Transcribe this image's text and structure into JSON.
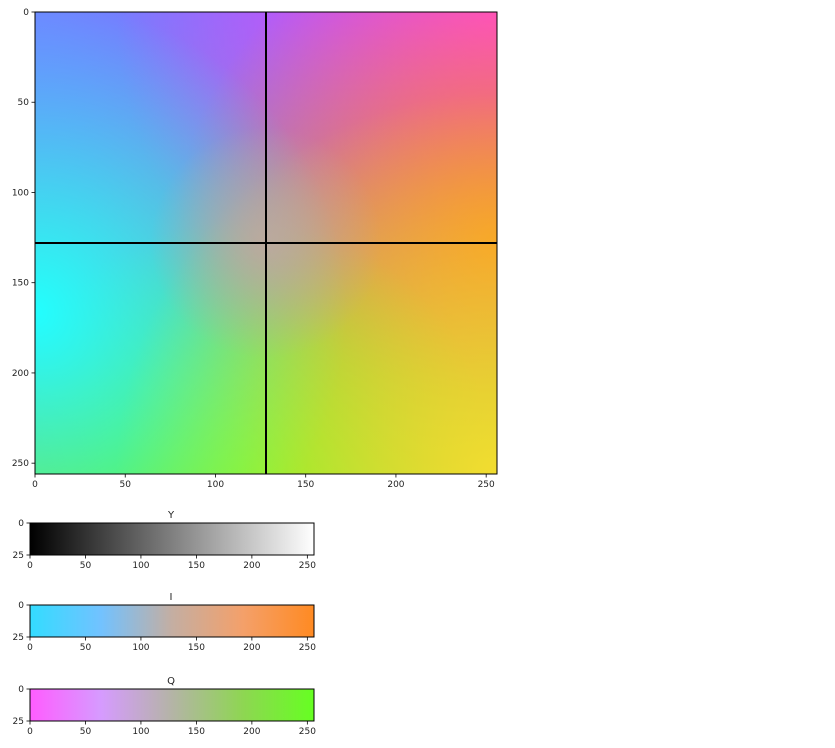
{
  "chart_data": [
    {
      "type": "heatmap",
      "title": "",
      "xlabel": "",
      "ylabel": "",
      "xlim": [
        0,
        256
      ],
      "ylim": [
        256,
        0
      ],
      "x_ticks": [
        0,
        50,
        100,
        150,
        200,
        250
      ],
      "y_ticks": [
        0,
        50,
        100,
        150,
        200,
        250
      ],
      "corner_colors": {
        "top_left": "#6f86ff",
        "top_right": "#ff3ff0",
        "bottom_left": "#22ffff",
        "bottom_right": "#f2dd30",
        "center": "#bfa8a0"
      },
      "crosshair_lines": {
        "vertical_x": 128,
        "horizontal_y": 128,
        "color": "#000000"
      },
      "grid": false,
      "legend": "none"
    },
    {
      "type": "heatmap",
      "title": "Y",
      "xlim": [
        0,
        256
      ],
      "ylim": [
        25,
        0
      ],
      "x_ticks": [
        0,
        50,
        100,
        150,
        200,
        250
      ],
      "y_ticks": [
        0,
        25
      ],
      "gradient_stops": [
        {
          "x": 0,
          "color": "#000000"
        },
        {
          "x": 256,
          "color": "#ffffff"
        }
      ],
      "grid": false
    },
    {
      "type": "heatmap",
      "title": "I",
      "xlim": [
        0,
        256
      ],
      "ylim": [
        25,
        0
      ],
      "x_ticks": [
        0,
        50,
        100,
        150,
        200,
        250
      ],
      "y_ticks": [
        0,
        25
      ],
      "gradient_stops": [
        {
          "x": 0,
          "color": "#33dcff"
        },
        {
          "x": 64,
          "color": "#72c2ff"
        },
        {
          "x": 128,
          "color": "#c4aea2"
        },
        {
          "x": 192,
          "color": "#f4a06a"
        },
        {
          "x": 256,
          "color": "#ff8a22"
        }
      ],
      "grid": false
    },
    {
      "type": "heatmap",
      "title": "Q",
      "xlim": [
        0,
        256
      ],
      "ylim": [
        25,
        0
      ],
      "x_ticks": [
        0,
        50,
        100,
        150,
        200,
        250
      ],
      "y_ticks": [
        0,
        25
      ],
      "gradient_stops": [
        {
          "x": 0,
          "color": "#ff5cff"
        },
        {
          "x": 64,
          "color": "#d69bff"
        },
        {
          "x": 128,
          "color": "#b4b4a6"
        },
        {
          "x": 192,
          "color": "#8ed652"
        },
        {
          "x": 256,
          "color": "#66ff22"
        }
      ],
      "grid": false
    }
  ]
}
